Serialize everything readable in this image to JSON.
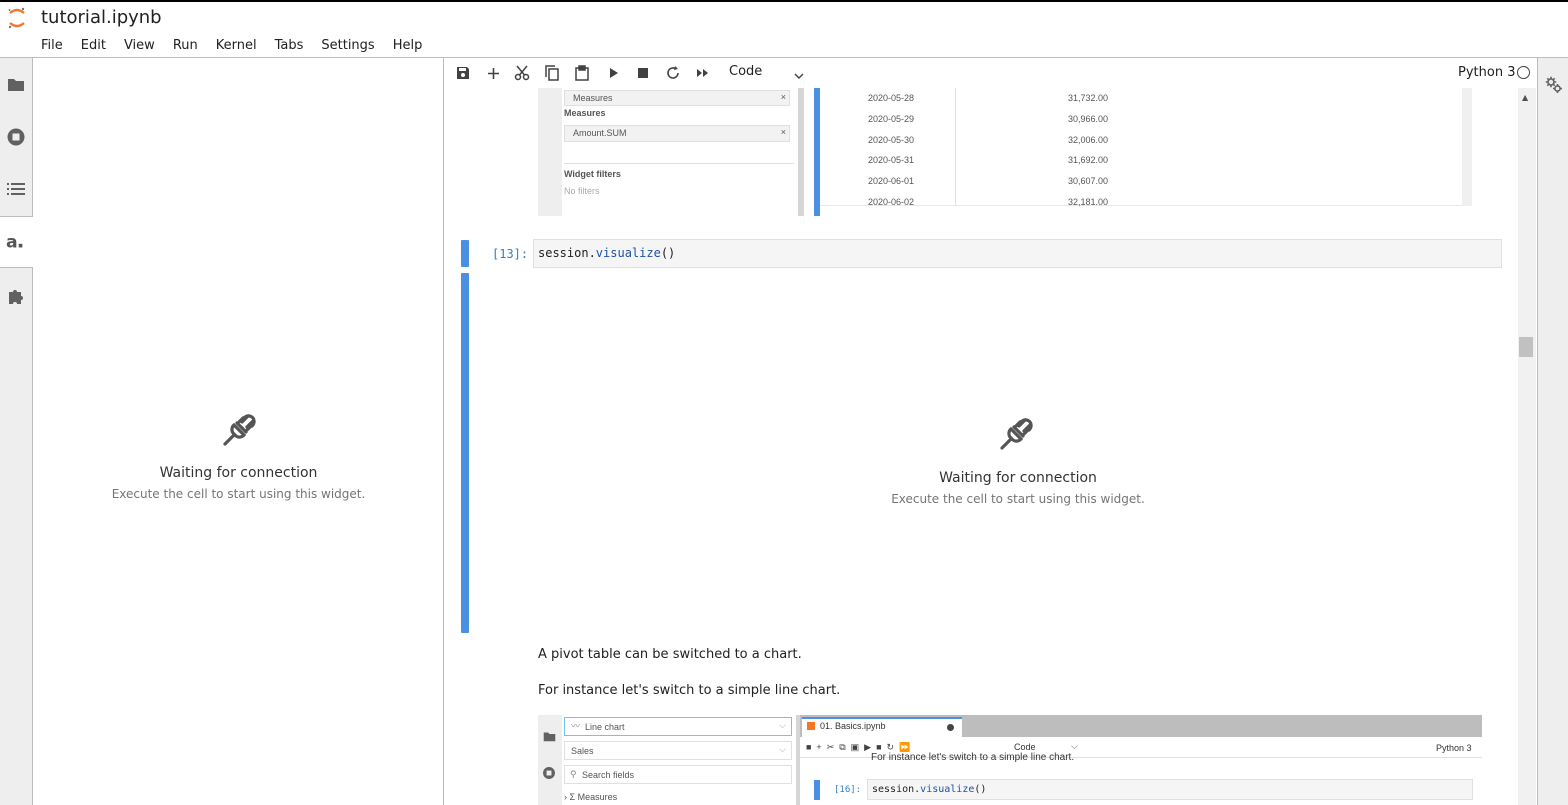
{
  "app": {
    "title": "tutorial.ipynb",
    "menu": [
      "File",
      "Edit",
      "View",
      "Run",
      "Kernel",
      "Tabs",
      "Settings",
      "Help"
    ]
  },
  "left_panel": {
    "waiting_title": "Waiting for connection",
    "waiting_sub": "Execute the cell to start using this widget."
  },
  "toolbar": {
    "cell_type": "Code",
    "kernel_name": "Python 3"
  },
  "top_image": {
    "measures_chip": "Measures",
    "measures_header": "Measures",
    "amount_chip": "Amount.SUM",
    "widget_filters": "Widget filters",
    "no_filters": "No filters",
    "rows": [
      {
        "date": "2020-05-28",
        "value": "31,732.00"
      },
      {
        "date": "2020-05-29",
        "value": "30,966.00"
      },
      {
        "date": "2020-05-30",
        "value": "32,006.00"
      },
      {
        "date": "2020-05-31",
        "value": "31,692.00"
      },
      {
        "date": "2020-06-01",
        "value": "30,607.00"
      },
      {
        "date": "2020-06-02",
        "value": "32,181.00"
      }
    ]
  },
  "cell13": {
    "prompt": "[13]:",
    "code_obj": "session.",
    "code_fn": "visualize",
    "code_tail": "()"
  },
  "output": {
    "waiting_title": "Waiting for connection",
    "waiting_sub": "Execute the cell to start using this widget."
  },
  "markdown": {
    "line1": "A pivot table can be switched to a chart.",
    "line2": "For instance let's switch to a simple line chart."
  },
  "bottom_image": {
    "chart_select": "Line chart",
    "cube_select": "Sales",
    "search_placeholder": "Search fields",
    "measures_tree": "Σ Measures",
    "tab_name": "01. Basics.ipynb",
    "cell_type": "Code",
    "kernel_name": "Python 3",
    "prev_text": "For instance let's switch to a simple line chart.",
    "prompt": "[16]:",
    "code_obj": "session.",
    "code_fn": "visualize",
    "code_tail": "()"
  }
}
